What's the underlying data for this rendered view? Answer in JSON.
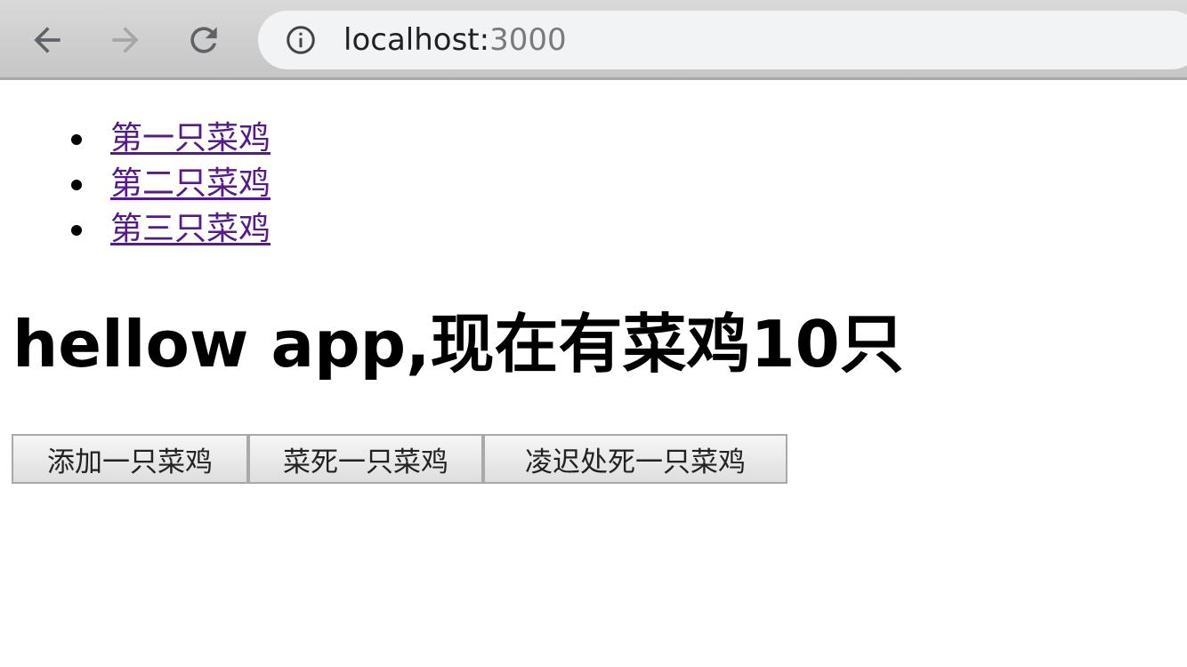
{
  "browser": {
    "url_host": "localhost:",
    "url_port": "3000",
    "icons": {
      "back": "arrow-left-icon",
      "forward": "arrow-right-icon",
      "reload": "reload-icon",
      "info": "info-icon"
    }
  },
  "list": {
    "items": [
      {
        "label": "第一只菜鸡"
      },
      {
        "label": "第二只菜鸡"
      },
      {
        "label": "第三只菜鸡"
      }
    ]
  },
  "headline": "hellow app,现在有菜鸡10只",
  "buttons": {
    "add": "添加一只菜鸡",
    "kill": "菜死一只菜鸡",
    "execute": "凌迟处死一只菜鸡"
  },
  "colors": {
    "link": "#551a8b",
    "toolbar": "#d0d0d0",
    "address_bar": "#f1f3f4"
  }
}
